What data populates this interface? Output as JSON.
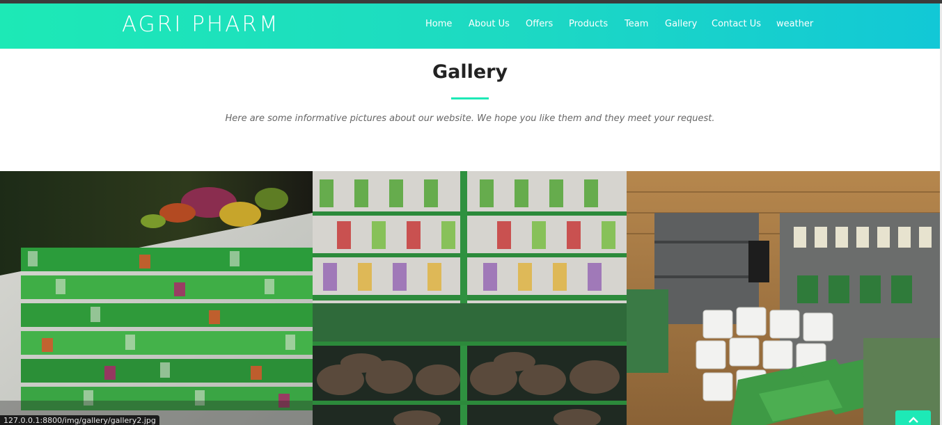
{
  "brand": {
    "name": "AGRI PHARM"
  },
  "nav": {
    "items": [
      {
        "label": "Home"
      },
      {
        "label": "About Us"
      },
      {
        "label": "Offers"
      },
      {
        "label": "Products"
      },
      {
        "label": "Team"
      },
      {
        "label": "Gallery"
      },
      {
        "label": "Contact Us"
      },
      {
        "label": "weather"
      }
    ]
  },
  "gallery": {
    "title": "Gallery",
    "subtitle": "Here are some informative pictures about our website. We hope you like them and they meet your request.",
    "images": [
      {
        "name": "seed-packets-wall-photo"
      },
      {
        "name": "seed-shelves-photo"
      },
      {
        "name": "garden-store-interior-photo"
      }
    ]
  },
  "statusbar": {
    "url": "127.0.0.1:8800/img/gallery/gallery2.jpg"
  },
  "back_to_top": {
    "icon": "chevron-up-icon"
  },
  "colors": {
    "accent": "#1de9b6",
    "accent_end": "#12c8d6",
    "title": "#222222",
    "subtitle": "#666666"
  }
}
